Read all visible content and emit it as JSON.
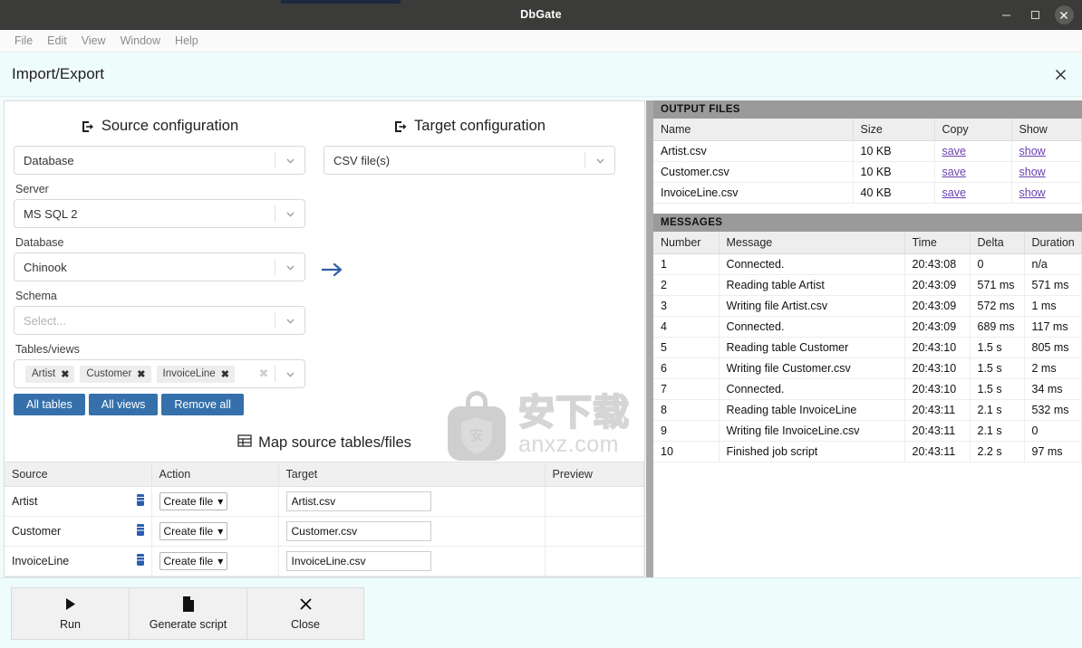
{
  "window": {
    "title": "DbGate",
    "controls": {
      "minimize": "minimize-icon",
      "maximize": "maximize-icon",
      "close": "close-icon"
    }
  },
  "menubar": {
    "items": [
      "File",
      "Edit",
      "View",
      "Window",
      "Help"
    ]
  },
  "page": {
    "title": "Import/Export",
    "close_label": "×"
  },
  "source": {
    "heading": "Source configuration",
    "type_value": "Database",
    "server_label": "Server",
    "server_value": "MS SQL 2",
    "database_label": "Database",
    "database_value": "Chinook",
    "schema_label": "Schema",
    "schema_placeholder": "Select...",
    "tables_label": "Tables/views",
    "chips": [
      "Artist",
      "Customer",
      "InvoiceLine"
    ],
    "buttons": [
      "All tables",
      "All views",
      "Remove all"
    ]
  },
  "target": {
    "heading": "Target configuration",
    "type_value": "CSV file(s)"
  },
  "watermark": {
    "cn": "安下载",
    "url": "anxz.com"
  },
  "map": {
    "heading": "Map source tables/files",
    "columns": [
      "Source",
      "Action",
      "Target",
      "Preview"
    ],
    "rows": [
      {
        "source": "Artist",
        "action": "Create file",
        "target": "Artist.csv",
        "preview": ""
      },
      {
        "source": "Customer",
        "action": "Create file",
        "target": "Customer.csv",
        "preview": ""
      },
      {
        "source": "InvoiceLine",
        "action": "Create file",
        "target": "InvoiceLine.csv",
        "preview": ""
      }
    ]
  },
  "output_files": {
    "section_title": "OUTPUT FILES",
    "columns": [
      "Name",
      "Size",
      "Copy",
      "Show"
    ],
    "rows": [
      {
        "name": "Artist.csv",
        "size": "10 KB",
        "copy": "save",
        "show": "show"
      },
      {
        "name": "Customer.csv",
        "size": "10 KB",
        "copy": "save",
        "show": "show"
      },
      {
        "name": "InvoiceLine.csv",
        "size": "40 KB",
        "copy": "save",
        "show": "show"
      }
    ]
  },
  "messages": {
    "section_title": "MESSAGES",
    "columns": [
      "Number",
      "Message",
      "Time",
      "Delta",
      "Duration"
    ],
    "rows": [
      {
        "number": "1",
        "message": "Connected.",
        "time": "20:43:08",
        "delta": "0",
        "duration": "n/a"
      },
      {
        "number": "2",
        "message": "Reading table Artist",
        "time": "20:43:09",
        "delta": "571 ms",
        "duration": "571 ms"
      },
      {
        "number": "3",
        "message": "Writing file Artist.csv",
        "time": "20:43:09",
        "delta": "572 ms",
        "duration": "1 ms"
      },
      {
        "number": "4",
        "message": "Connected.",
        "time": "20:43:09",
        "delta": "689 ms",
        "duration": "117 ms"
      },
      {
        "number": "5",
        "message": "Reading table Customer",
        "time": "20:43:10",
        "delta": "1.5 s",
        "duration": "805 ms"
      },
      {
        "number": "6",
        "message": "Writing file Customer.csv",
        "time": "20:43:10",
        "delta": "1.5 s",
        "duration": "2 ms"
      },
      {
        "number": "7",
        "message": "Connected.",
        "time": "20:43:10",
        "delta": "1.5 s",
        "duration": "34 ms"
      },
      {
        "number": "8",
        "message": "Reading table InvoiceLine",
        "time": "20:43:11",
        "delta": "2.1 s",
        "duration": "532 ms"
      },
      {
        "number": "9",
        "message": "Writing file InvoiceLine.csv",
        "time": "20:43:11",
        "delta": "2.1 s",
        "duration": "0"
      },
      {
        "number": "10",
        "message": "Finished job script",
        "time": "20:43:11",
        "delta": "2.2 s",
        "duration": "97 ms"
      }
    ]
  },
  "bottom": {
    "buttons": [
      {
        "label": "Run",
        "icon": "play-icon"
      },
      {
        "label": "Generate script",
        "icon": "file-icon"
      },
      {
        "label": "Close",
        "icon": "close-icon"
      }
    ]
  },
  "colors": {
    "accent_blue": "#3570ab",
    "arrow_blue": "#2f5fa8",
    "link_purple": "#6a3fb0",
    "header_bg": "#effcfc",
    "section_bg": "#9a9a9a",
    "titlebar_bg": "#3b3b39"
  }
}
